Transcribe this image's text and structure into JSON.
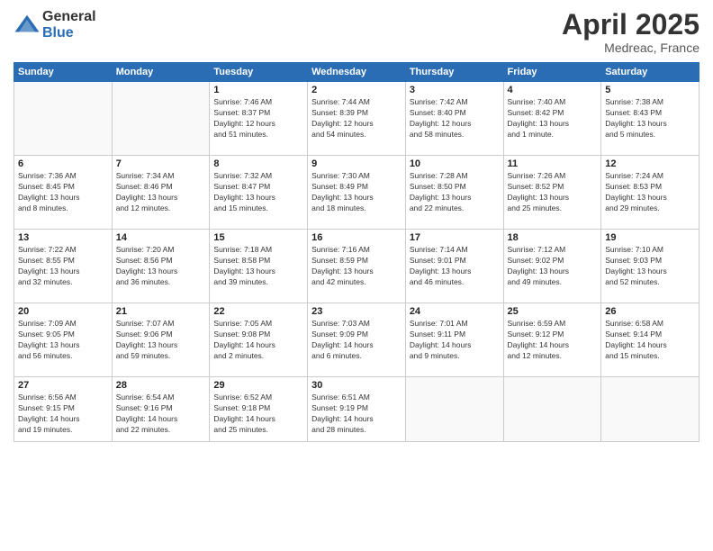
{
  "header": {
    "logo_general": "General",
    "logo_blue": "Blue",
    "month": "April 2025",
    "location": "Medreac, France"
  },
  "weekdays": [
    "Sunday",
    "Monday",
    "Tuesday",
    "Wednesday",
    "Thursday",
    "Friday",
    "Saturday"
  ],
  "weeks": [
    [
      {
        "day": "",
        "info": ""
      },
      {
        "day": "",
        "info": ""
      },
      {
        "day": "1",
        "info": "Sunrise: 7:46 AM\nSunset: 8:37 PM\nDaylight: 12 hours\nand 51 minutes."
      },
      {
        "day": "2",
        "info": "Sunrise: 7:44 AM\nSunset: 8:39 PM\nDaylight: 12 hours\nand 54 minutes."
      },
      {
        "day": "3",
        "info": "Sunrise: 7:42 AM\nSunset: 8:40 PM\nDaylight: 12 hours\nand 58 minutes."
      },
      {
        "day": "4",
        "info": "Sunrise: 7:40 AM\nSunset: 8:42 PM\nDaylight: 13 hours\nand 1 minute."
      },
      {
        "day": "5",
        "info": "Sunrise: 7:38 AM\nSunset: 8:43 PM\nDaylight: 13 hours\nand 5 minutes."
      }
    ],
    [
      {
        "day": "6",
        "info": "Sunrise: 7:36 AM\nSunset: 8:45 PM\nDaylight: 13 hours\nand 8 minutes."
      },
      {
        "day": "7",
        "info": "Sunrise: 7:34 AM\nSunset: 8:46 PM\nDaylight: 13 hours\nand 12 minutes."
      },
      {
        "day": "8",
        "info": "Sunrise: 7:32 AM\nSunset: 8:47 PM\nDaylight: 13 hours\nand 15 minutes."
      },
      {
        "day": "9",
        "info": "Sunrise: 7:30 AM\nSunset: 8:49 PM\nDaylight: 13 hours\nand 18 minutes."
      },
      {
        "day": "10",
        "info": "Sunrise: 7:28 AM\nSunset: 8:50 PM\nDaylight: 13 hours\nand 22 minutes."
      },
      {
        "day": "11",
        "info": "Sunrise: 7:26 AM\nSunset: 8:52 PM\nDaylight: 13 hours\nand 25 minutes."
      },
      {
        "day": "12",
        "info": "Sunrise: 7:24 AM\nSunset: 8:53 PM\nDaylight: 13 hours\nand 29 minutes."
      }
    ],
    [
      {
        "day": "13",
        "info": "Sunrise: 7:22 AM\nSunset: 8:55 PM\nDaylight: 13 hours\nand 32 minutes."
      },
      {
        "day": "14",
        "info": "Sunrise: 7:20 AM\nSunset: 8:56 PM\nDaylight: 13 hours\nand 36 minutes."
      },
      {
        "day": "15",
        "info": "Sunrise: 7:18 AM\nSunset: 8:58 PM\nDaylight: 13 hours\nand 39 minutes."
      },
      {
        "day": "16",
        "info": "Sunrise: 7:16 AM\nSunset: 8:59 PM\nDaylight: 13 hours\nand 42 minutes."
      },
      {
        "day": "17",
        "info": "Sunrise: 7:14 AM\nSunset: 9:01 PM\nDaylight: 13 hours\nand 46 minutes."
      },
      {
        "day": "18",
        "info": "Sunrise: 7:12 AM\nSunset: 9:02 PM\nDaylight: 13 hours\nand 49 minutes."
      },
      {
        "day": "19",
        "info": "Sunrise: 7:10 AM\nSunset: 9:03 PM\nDaylight: 13 hours\nand 52 minutes."
      }
    ],
    [
      {
        "day": "20",
        "info": "Sunrise: 7:09 AM\nSunset: 9:05 PM\nDaylight: 13 hours\nand 56 minutes."
      },
      {
        "day": "21",
        "info": "Sunrise: 7:07 AM\nSunset: 9:06 PM\nDaylight: 13 hours\nand 59 minutes."
      },
      {
        "day": "22",
        "info": "Sunrise: 7:05 AM\nSunset: 9:08 PM\nDaylight: 14 hours\nand 2 minutes."
      },
      {
        "day": "23",
        "info": "Sunrise: 7:03 AM\nSunset: 9:09 PM\nDaylight: 14 hours\nand 6 minutes."
      },
      {
        "day": "24",
        "info": "Sunrise: 7:01 AM\nSunset: 9:11 PM\nDaylight: 14 hours\nand 9 minutes."
      },
      {
        "day": "25",
        "info": "Sunrise: 6:59 AM\nSunset: 9:12 PM\nDaylight: 14 hours\nand 12 minutes."
      },
      {
        "day": "26",
        "info": "Sunrise: 6:58 AM\nSunset: 9:14 PM\nDaylight: 14 hours\nand 15 minutes."
      }
    ],
    [
      {
        "day": "27",
        "info": "Sunrise: 6:56 AM\nSunset: 9:15 PM\nDaylight: 14 hours\nand 19 minutes."
      },
      {
        "day": "28",
        "info": "Sunrise: 6:54 AM\nSunset: 9:16 PM\nDaylight: 14 hours\nand 22 minutes."
      },
      {
        "day": "29",
        "info": "Sunrise: 6:52 AM\nSunset: 9:18 PM\nDaylight: 14 hours\nand 25 minutes."
      },
      {
        "day": "30",
        "info": "Sunrise: 6:51 AM\nSunset: 9:19 PM\nDaylight: 14 hours\nand 28 minutes."
      },
      {
        "day": "",
        "info": ""
      },
      {
        "day": "",
        "info": ""
      },
      {
        "day": "",
        "info": ""
      }
    ]
  ]
}
